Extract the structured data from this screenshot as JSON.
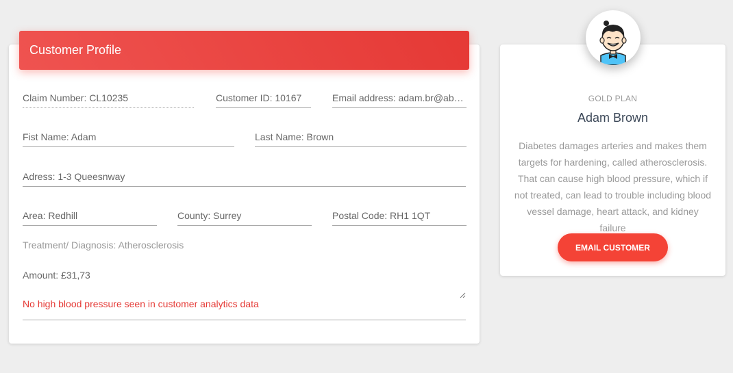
{
  "profile_form": {
    "header_title": "Customer Profile",
    "fields": {
      "claim_number": "Claim Number: CL10235",
      "customer_id": "Customer ID: 10167",
      "email": "Email address: adam.br@abc.com",
      "first_name": "Fist Name: Adam",
      "last_name": "Last Name: Brown",
      "address": "Adress: 1-3 Queesnway",
      "area": "Area: Redhill",
      "county": "County: Surrey",
      "postal_code": "Postal Code: RH1 1QT"
    },
    "treatment": "Treatment/ Diagnosis: Atherosclerosis",
    "amount": "Amount: £31,73",
    "note": "No high blood pressure seen in customer analytics data"
  },
  "profile_card": {
    "plan": "GOLD PLAN",
    "name": "Adam Brown",
    "description": "Diabetes damages arteries and makes them targets for hardening, called atherosclerosis. That can cause high blood pressure, which if not treated, can lead to trouble including blood vessel damage, heart attack, and kidney failure",
    "button_label": "EMAIL CUSTOMER",
    "avatar_icon": "cartoon-boy-avatar-icon"
  },
  "colors": {
    "accent": "#f44336",
    "header_gradient_start": "#ef5350",
    "header_gradient_end": "#e53935",
    "alert_text": "#e53935"
  }
}
